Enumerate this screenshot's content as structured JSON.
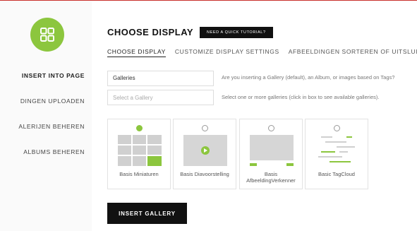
{
  "sidebar": {
    "items": [
      {
        "label": "INSERT INTO PAGE",
        "active": true
      },
      {
        "label": "DINGEN UPLOADEN"
      },
      {
        "label": "ALERIJEN BEHEREN"
      },
      {
        "label": "ALBUMS BEHEREN"
      }
    ],
    "logo_icon": "grid-icon",
    "accent": "#8cc63e"
  },
  "header": {
    "title": "CHOOSE DISPLAY",
    "tutorial_label": "NEED A QUICK TUTORIAL?"
  },
  "tabs": [
    {
      "label": "CHOOSE DISPLAY",
      "active": true
    },
    {
      "label": "CUSTOMIZE DISPLAY SETTINGS"
    },
    {
      "label": "AFBEELDINGEN SORTEREN OF UITSLUITEN"
    }
  ],
  "form": {
    "source_value": "Galleries",
    "source_hint": "Are you inserting a Gallery (default), an Album, or images based on Tags?",
    "gallery_placeholder": "Select a Gallery",
    "gallery_hint": "Select one or more galleries (click in box to see available galleries)."
  },
  "display_types": [
    {
      "label": "Basis Miniaturen",
      "selected": true
    },
    {
      "label": "Basis Diavoorstelling",
      "selected": false
    },
    {
      "label": "Basis AfbeeldingVerkenner",
      "selected": false
    },
    {
      "label": "Basic TagCloud",
      "selected": false
    }
  ],
  "insert_label": "INSERT GALLERY",
  "colors": {
    "accent": "#8cc63e",
    "dark": "#111111",
    "top_border": "#c9302c"
  }
}
